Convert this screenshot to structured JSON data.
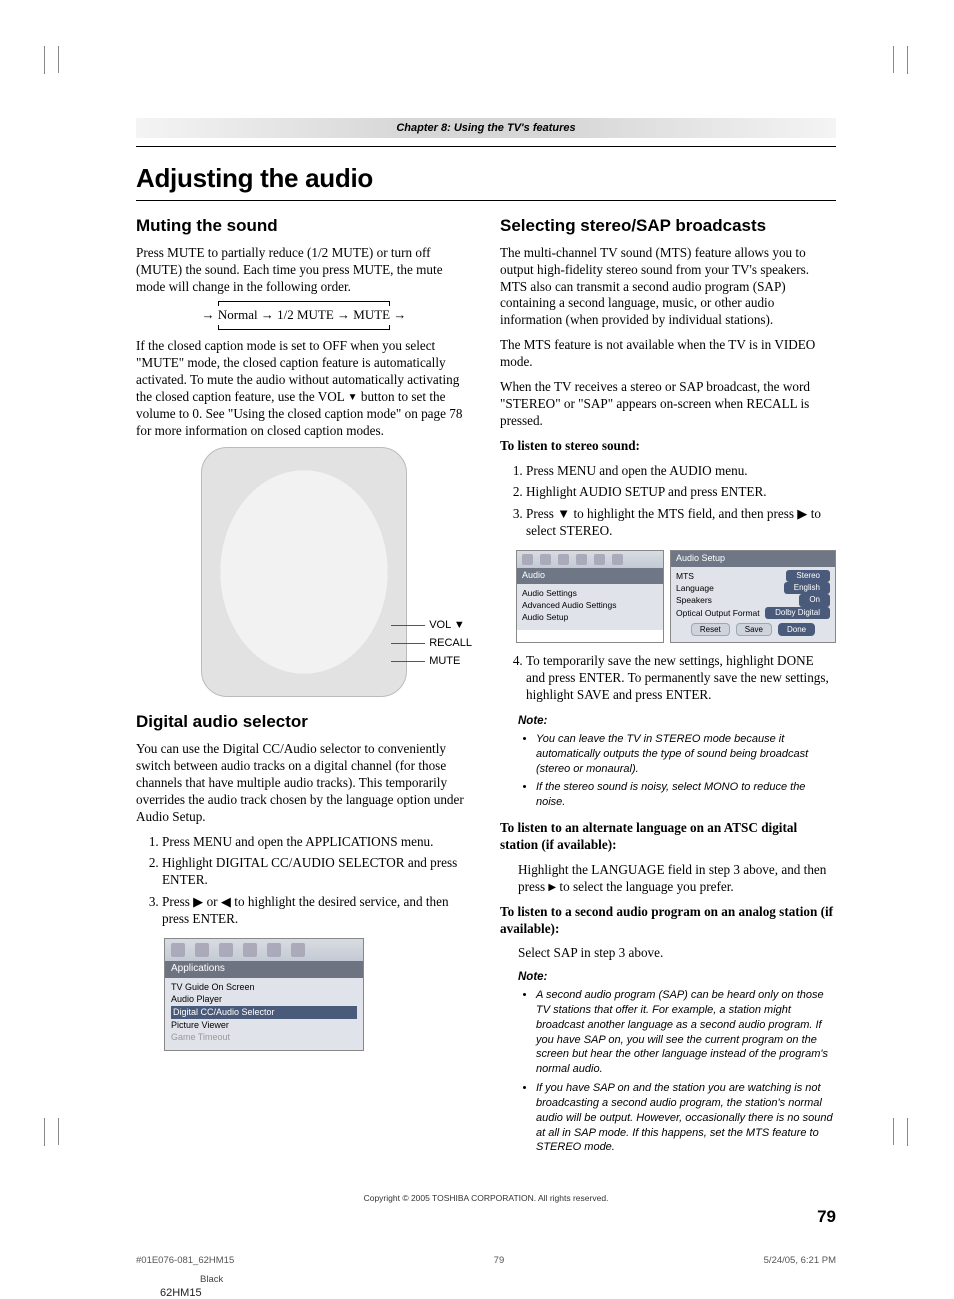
{
  "chapter_bar": "Chapter 8: Using the TV's features",
  "h1": "Adjusting the audio",
  "left": {
    "h2a": "Muting the sound",
    "p1": "Press MUTE to partially reduce (1/2 MUTE) or turn off (MUTE) the sound. Each time you press MUTE, the mute mode will change in the following order.",
    "cycle": "→ Normal → 1/2 MUTE → MUTE →",
    "p2a": "If the closed caption mode is set to OFF when you select \"MUTE\" mode, the closed caption feature is automatically activated. To mute the audio without automatically activating the closed caption feature, use the VOL ",
    "p2b": " button to set the volume to 0. See \"Using the closed caption mode\" on page 78 for more information on closed caption modes.",
    "callouts": {
      "a": "VOL ▼",
      "b": "RECALL",
      "c": "MUTE"
    },
    "h2b": "Digital audio selector",
    "p3": "You can use the Digital CC/Audio selector to conveniently switch between audio tracks on a digital channel (for those channels that have multiple audio tracks). This temporarily overrides the audio track chosen by the language option under Audio Setup.",
    "steps": [
      "Press MENU and open the APPLICATIONS menu.",
      "Highlight DIGITAL CC/AUDIO SELECTOR and press ENTER.",
      "Press ▶ or ◀ to highlight the desired service, and then press ENTER."
    ],
    "osd": {
      "title": "Applications",
      "items": [
        "TV Guide On Screen",
        "Audio Player",
        "Digital CC/Audio Selector",
        "Picture Viewer",
        "Game Timeout"
      ]
    }
  },
  "right": {
    "h2": "Selecting stereo/SAP broadcasts",
    "p1": "The multi-channel TV sound (MTS) feature allows you to output high-fidelity stereo sound from your TV's speakers. MTS also can transmit a second audio program (SAP) containing a second language, music, or other audio information (when provided by individual stations).",
    "p2": "The MTS feature is not available when the TV is in VIDEO mode.",
    "p3": "When the TV receives a stereo or SAP broadcast, the word \"STEREO\" or \"SAP\" appears on-screen when RECALL is pressed.",
    "sub1": "To listen to stereo sound:",
    "steps1": [
      "Press MENU and open the AUDIO menu.",
      "Highlight AUDIO SETUP and press ENTER.",
      "Press ▼ to highlight the MTS field, and then press ▶ to select STEREO."
    ],
    "osd_left": {
      "title": "Audio",
      "items": [
        "Audio Settings",
        "Advanced Audio Settings",
        "Audio Setup"
      ]
    },
    "osd_right": {
      "title": "Audio Setup",
      "rows": [
        {
          "label": "MTS",
          "value": "Stereo"
        },
        {
          "label": "Language",
          "value": "English"
        },
        {
          "label": "Speakers",
          "value": "On"
        },
        {
          "label": "Optical Output Format",
          "value": "Dolby Digital"
        }
      ],
      "buttons": [
        "Reset",
        "Save",
        "Done"
      ]
    },
    "step4": "To temporarily save the new settings, highlight DONE and press ENTER. To permanently save the new settings, highlight SAVE and press ENTER.",
    "note_head": "Note:",
    "notes1": [
      "You can leave the TV in STEREO mode because it automatically outputs the type of sound being broadcast (stereo or monaural).",
      "If the stereo sound is noisy, select MONO to reduce the noise."
    ],
    "sub2": "To listen to an alternate language on an ATSC digital station (if available):",
    "p4a": "Highlight the LANGUAGE field in step 3 above, and then press ",
    "p4b": " to select the language you prefer.",
    "sub3": "To listen to a second audio program on an analog station (if available):",
    "p5": "Select SAP in step 3 above.",
    "notes2": [
      "A second audio program (SAP) can be heard only on those TV stations that offer it. For example, a station might broadcast another language as a second audio program. If you have SAP on, you will see the current program on the screen but hear the other language instead of the program's normal audio.",
      "If you have SAP on and the station you are watching is not broadcasting a second audio program, the station's normal audio will be output. However, occasionally there is no sound at all in SAP mode. If this happens, set the MTS feature to STEREO mode."
    ]
  },
  "copyright": "Copyright © 2005 TOSHIBA CORPORATION. All rights reserved.",
  "pagenum": "79",
  "footer": {
    "file": "#01E076-081_62HM15",
    "pg": "79",
    "ts": "5/24/05, 6:21 PM",
    "color": "Black",
    "model": "62HM15"
  }
}
